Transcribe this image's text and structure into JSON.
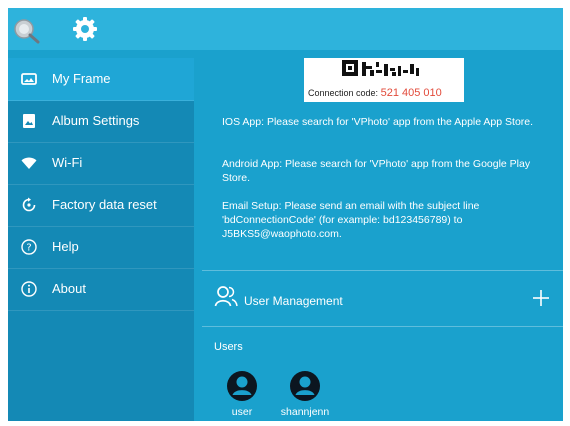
{
  "header": {
    "icons": [
      "search-icon",
      "gear-icon"
    ]
  },
  "sidebar": {
    "items": [
      {
        "label": "My Frame",
        "icon": "frame-icon",
        "active": true
      },
      {
        "label": "Album Settings",
        "icon": "album-icon",
        "active": false
      },
      {
        "label": "Wi-Fi",
        "icon": "wifi-icon",
        "active": false
      },
      {
        "label": "Factory data reset",
        "icon": "reset-icon",
        "active": false
      },
      {
        "label": "Help",
        "icon": "help-icon",
        "active": false
      },
      {
        "label": "About",
        "icon": "info-icon",
        "active": false
      }
    ]
  },
  "main": {
    "connection_label": "Connection code:",
    "connection_code": "521 405 010",
    "instructions": {
      "ios": "IOS App: Please search for 'VPhoto' app from the Apple App Store.",
      "android": "Android App: Please search for 'VPhoto' app from the Google Play Store.",
      "email": "Email Setup: Please send an email with the subject line 'bdConnectionCode' (for example: bd123456789) to J5BKS5@waophoto.com."
    },
    "user_management": {
      "label": "User Management",
      "add_symbol": "+"
    },
    "users_label": "Users",
    "users": [
      {
        "name": "user"
      },
      {
        "name": "shannjenn"
      }
    ]
  },
  "colors": {
    "background": "#1aa1cd",
    "topbar": "#2eb3dc",
    "sidebar": "#1489b5",
    "active_item": "#1fa6d6",
    "code_red": "#e24b3b"
  }
}
